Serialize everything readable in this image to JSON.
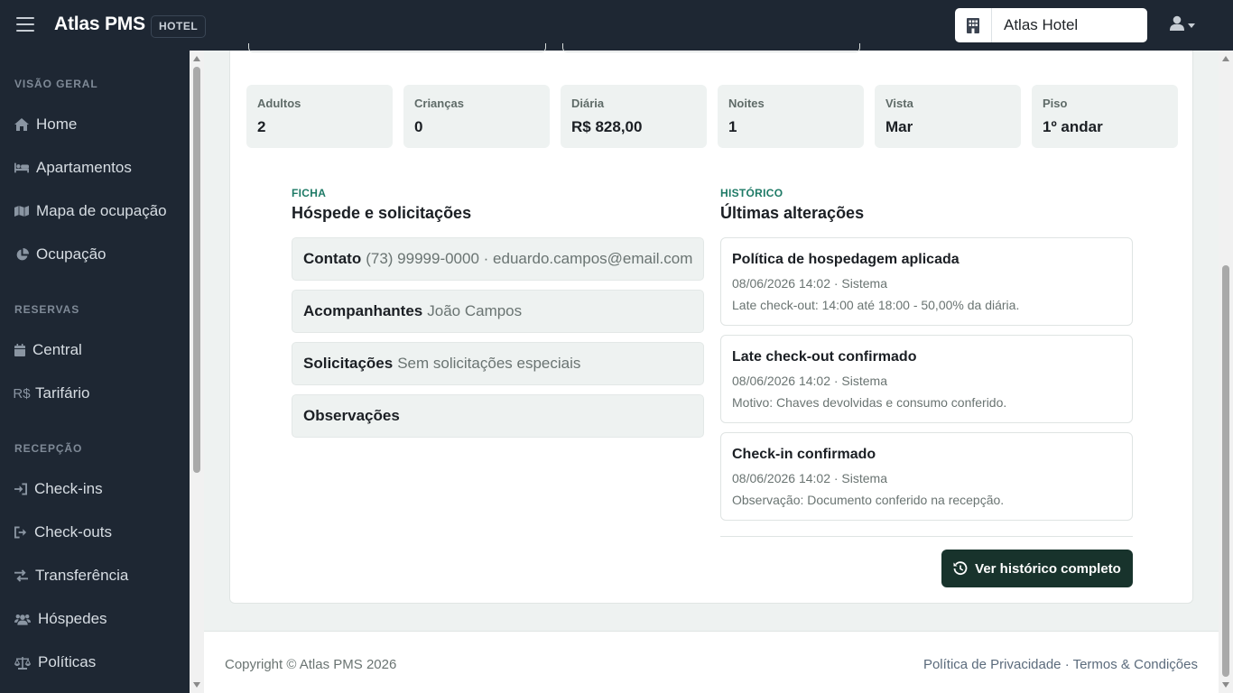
{
  "topbar": {
    "brand": "Atlas PMS",
    "badge": "HOTEL",
    "hotel_select": "Atlas Hotel"
  },
  "sidebar": {
    "sections": [
      {
        "title": "VISÃO GERAL",
        "items": [
          {
            "label": "Home",
            "icon": "home-icon"
          },
          {
            "label": "Apartamentos",
            "icon": "bed-icon"
          },
          {
            "label": "Mapa de ocupação",
            "icon": "map-icon"
          },
          {
            "label": "Ocupação",
            "icon": "pie-chart-icon"
          }
        ]
      },
      {
        "title": "RESERVAS",
        "items": [
          {
            "label": "Central",
            "icon": "calendar-icon"
          },
          {
            "label": "Tarifário",
            "icon": "currency-icon",
            "icon_text": "R$"
          }
        ]
      },
      {
        "title": "RECEPÇÃO",
        "items": [
          {
            "label": "Check-ins",
            "icon": "sign-in-icon"
          },
          {
            "label": "Check-outs",
            "icon": "sign-out-icon"
          },
          {
            "label": "Transferência",
            "icon": "transfer-icon"
          },
          {
            "label": "Hóspedes",
            "icon": "users-icon"
          },
          {
            "label": "Políticas",
            "icon": "scale-icon"
          }
        ]
      }
    ]
  },
  "stats": [
    {
      "label": "Adultos",
      "value": "2"
    },
    {
      "label": "Crianças",
      "value": "0"
    },
    {
      "label": "Diária",
      "value": "R$ 828,00"
    },
    {
      "label": "Noites",
      "value": "1"
    },
    {
      "label": "Vista",
      "value": "Mar"
    },
    {
      "label": "Piso",
      "value": "1º andar"
    }
  ],
  "ficha": {
    "kicker": "FICHA",
    "title": "Hóspede e solicitações",
    "rows": [
      {
        "label": "Contato",
        "value": "(73) 99999-0000 · eduardo.campos@email.com"
      },
      {
        "label": "Acompanhantes",
        "value": "João Campos"
      },
      {
        "label": "Solicitações",
        "value": "Sem solicitações especiais"
      },
      {
        "label": "Observações",
        "value": ""
      }
    ]
  },
  "historico": {
    "kicker": "HISTÓRICO",
    "title": "Últimas alterações",
    "entries": [
      {
        "title": "Política de hospedagem aplicada",
        "meta": "08/06/2026 14:02 · Sistema",
        "detail": "Late check-out: 14:00 até 18:00 - 50,00% da diária."
      },
      {
        "title": "Late check-out confirmado",
        "meta": "08/06/2026 14:02 · Sistema",
        "detail": "Motivo: Chaves devolvidas e consumo conferido."
      },
      {
        "title": "Check-in confirmado",
        "meta": "08/06/2026 14:02 · Sistema",
        "detail": "Observação: Documento conferido na recepção."
      }
    ],
    "button": "Ver histórico completo"
  },
  "footer": {
    "copyright": "Copyright © Atlas PMS 2026",
    "privacy": "Política de Privacidade",
    "separator": " · ",
    "terms": "Termos & Condições"
  },
  "colors": {
    "navbar": "#1e2733",
    "accent": "#1e7a66",
    "button": "#18332c"
  }
}
